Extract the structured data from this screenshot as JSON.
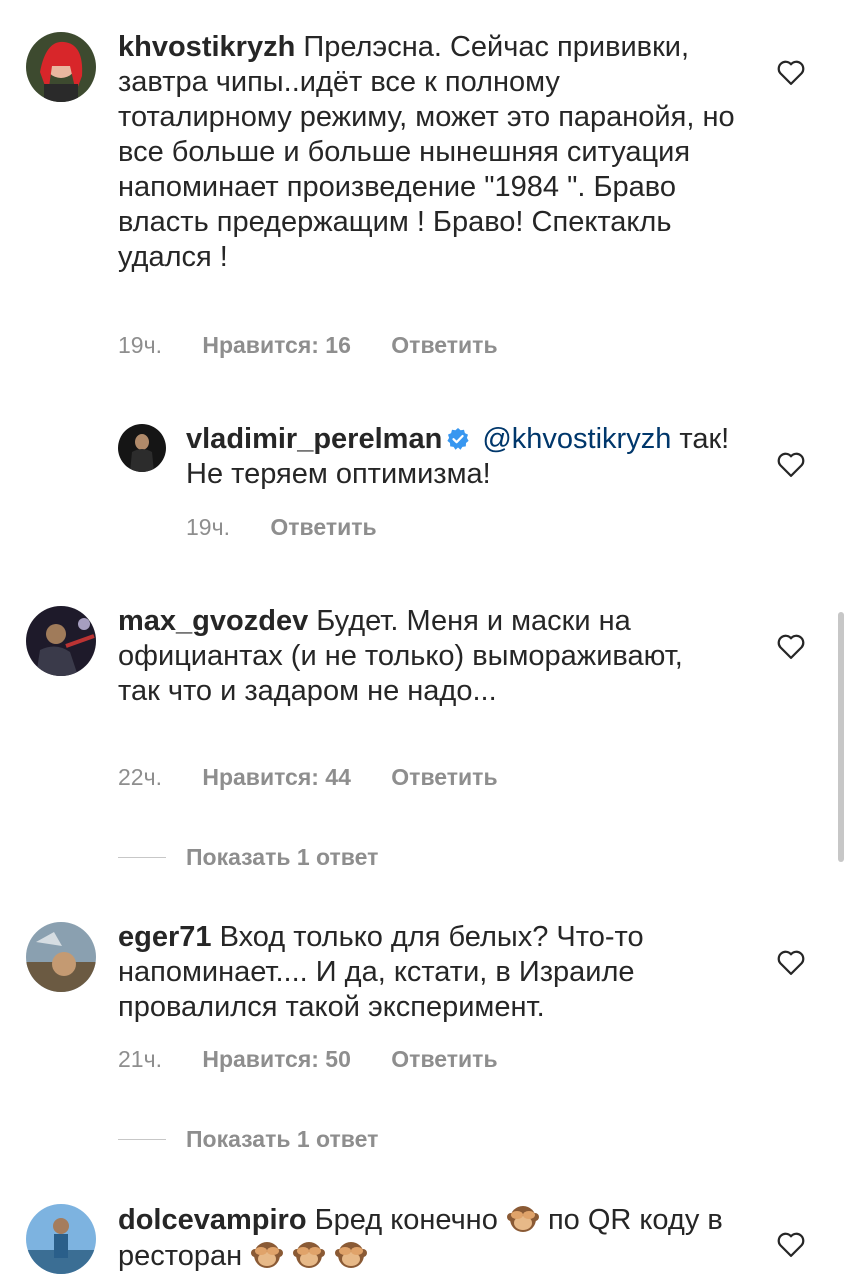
{
  "comments": [
    {
      "username": "khvostikryzh",
      "text": "Прелэсна. Сейчас прививки, завтра чипы..идёт все к полному тоталирному режиму, может это паранойя,  но все больше  и больше нынешняя ситуация  напоминает произведение \"1984 \". Браво власть предержащим ! Браво! Спектакль удался !",
      "time": "19ч.",
      "likes": "Нравится: 16",
      "reply": "Ответить"
    },
    {
      "username": "vladimir_perelman",
      "verified": true,
      "mention": "@khvostikryzh",
      "text": "так! Не теряем оптимизма!",
      "time": "19ч.",
      "reply": "Ответить"
    },
    {
      "username": "max_gvozdev",
      "text": "Будет. Меня и маски на официантах (и не только) вымораживают, так что и задаром не надо...",
      "time": "22ч.",
      "likes": "Нравится: 44",
      "reply": "Ответить",
      "show_replies": "Показать 1 ответ"
    },
    {
      "username": "eger71",
      "text": "Вход только для белых? Что-то напоминает.... И да, кстати, в Израиле провалился такой эксперимент.",
      "time": "21ч.",
      "likes": "Нравится: 50",
      "reply": "Ответить",
      "show_replies": "Показать 1 ответ"
    },
    {
      "username": "dolcevampiro",
      "text_part1": "Бред конечно",
      "text_part2": "по QR коду в ресторан",
      "emoji": "see-no-evil-monkey"
    }
  ],
  "colors": {
    "text": "#262626",
    "secondary": "#8e8e8e",
    "mention": "#00376b",
    "verified": "#3897f0"
  }
}
